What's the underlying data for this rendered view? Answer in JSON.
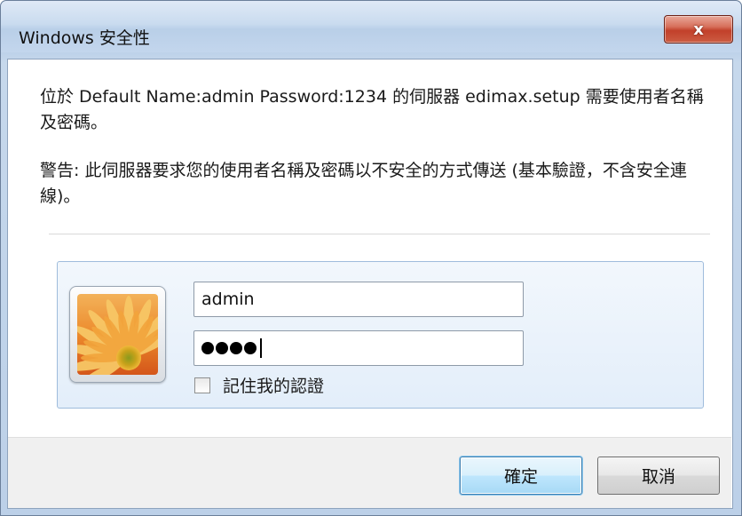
{
  "window": {
    "title": "Windows 安全性",
    "close_glyph": "x"
  },
  "message": {
    "line_request": "位於 Default Name:admin Password:1234 的伺服器 edimax.setup 需要使用者名稱及密碼。",
    "line_warning": "警告: 此伺服器要求您的使用者名稱及密碼以不安全的方式傳送 (基本驗證，不含安全連線)。"
  },
  "credentials": {
    "avatar_icon": "flower-user-tile-icon",
    "username_value": "admin",
    "password_masked": "●●●●",
    "password_length": 4,
    "remember_label": "記住我的認證",
    "remember_checked": false
  },
  "buttons": {
    "ok_label": "確定",
    "cancel_label": "取消"
  },
  "colors": {
    "accent_focus": "#3c7fb1",
    "close_red": "#c2402a",
    "panel_bg": "#e3eefa"
  }
}
